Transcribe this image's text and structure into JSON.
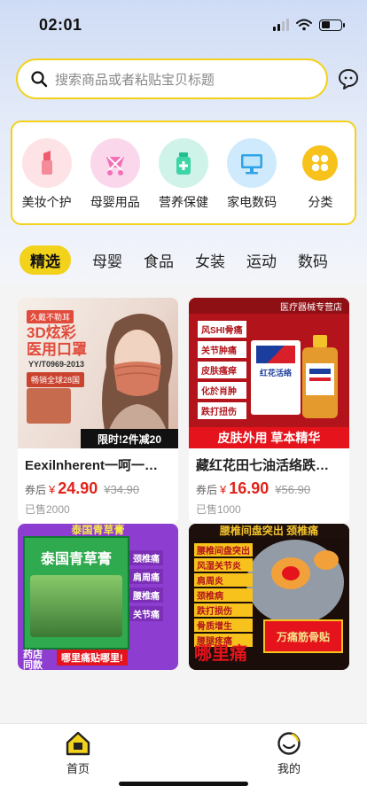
{
  "status": {
    "time": "02:01"
  },
  "search": {
    "placeholder": "搜索商品或者粘贴宝贝标题"
  },
  "categories": [
    {
      "label": "美妆个护",
      "icon": "lipstick-icon"
    },
    {
      "label": "母婴用品",
      "icon": "baby-stroller-icon"
    },
    {
      "label": "营养保健",
      "icon": "medicine-bottle-icon"
    },
    {
      "label": "家电数码",
      "icon": "monitor-icon"
    },
    {
      "label": "分类",
      "icon": "grid-icon"
    }
  ],
  "tabs": [
    "精选",
    "母婴",
    "食品",
    "女装",
    "运动",
    "数码"
  ],
  "products": [
    {
      "title": "Eexilnherent一呵一…",
      "price_label": "券后",
      "price_symbol": "¥",
      "price": "24.90",
      "old_price": "¥34.90",
      "sold": "已售2000",
      "image": {
        "badge": "久戴不勒耳",
        "headline": "3D炫彩\n医用口罩",
        "standard": "YY/T0969-2013",
        "sales": "畅销全球28国",
        "promo": "限时!2件减20"
      }
    },
    {
      "title": "藏红花田七油活络跌…",
      "price_label": "券后",
      "price_symbol": "¥",
      "price": "16.90",
      "old_price": "¥56.90",
      "sold": "已售1000",
      "image": {
        "store": "医疗器械专营店",
        "tags": [
          "风SHI骨痛",
          "关节肿痛",
          "皮肤瘙痒",
          "化於肖肿",
          "跌打扭伤"
        ],
        "bottle_label": "红花活络",
        "footer": "皮肤外用 草本精华"
      }
    },
    {
      "image": {
        "top": "泰国青草膏",
        "title": "泰国青草膏",
        "tags": [
          "颈椎痛",
          "肩周痛",
          "腰椎痛",
          "关节痛"
        ],
        "banner": "哪里痛贴哪里!",
        "side": "药店同款"
      }
    },
    {
      "image": {
        "top": "腰椎间盘突出 颈椎痛",
        "tags": [
          "腰椎间盘突出",
          "风湿关节炎",
          "肩周炎",
          "颈椎病",
          "跌打损伤",
          "骨质增生",
          "腰腿疼痛"
        ],
        "box": "万痛筋骨贴",
        "bottom": "哪里痛"
      }
    }
  ],
  "bottom_nav": [
    {
      "label": "首页",
      "icon": "home-icon"
    },
    {
      "label": "我的",
      "icon": "profile-icon"
    }
  ],
  "colors": {
    "accent": "#f3d21b",
    "price": "#e2231a"
  }
}
